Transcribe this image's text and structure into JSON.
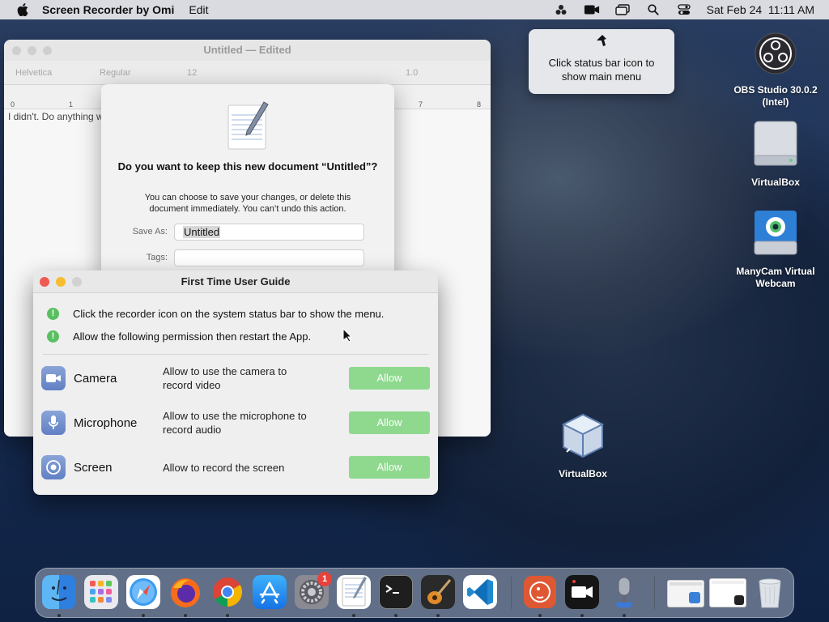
{
  "menubar": {
    "app_name": "Screen Recorder by Omi",
    "menu_edit": "Edit",
    "datetime": "Sat Feb 24  11:11 AM",
    "icons": [
      "apple-logo",
      "omi-icon",
      "camera-recorder-icon",
      "window-icon",
      "search-icon",
      "control-center-icon"
    ]
  },
  "tooltip": {
    "text": "Click status bar icon to show main menu"
  },
  "desktop": [
    {
      "name": "obs",
      "label": "OBS Studio 30.0.2 (Intel)"
    },
    {
      "name": "virtualbox-disk",
      "label": "VirtualBox"
    },
    {
      "name": "manycam",
      "label": "ManyCam Virtual Webcam"
    },
    {
      "name": "virtualbox-app",
      "label": "VirtualBox"
    }
  ],
  "textedit": {
    "title": "Untitled — Edited",
    "font": "Helvetica",
    "style": "Regular",
    "size": "12",
    "spacing": "1.0",
    "ruler": [
      "0",
      "1",
      "7",
      "8"
    ],
    "body_text": "I didn't. Do anything w"
  },
  "save_sheet": {
    "heading": "Do you want to keep this new document “Untitled”?",
    "description": "You can choose to save your changes, or delete this document immediately. You can’t undo this action.",
    "save_as_label": "Save As:",
    "save_as_value": "Untitled",
    "tags_label": "Tags:"
  },
  "guide": {
    "title": "First Time User Guide",
    "steps": [
      "Click the recorder icon on the system status bar to show the menu.",
      "Allow the following permission then restart the App."
    ],
    "permissions": [
      {
        "name": "Camera",
        "desc": "Allow to use the camera to record video",
        "button": "Allow"
      },
      {
        "name": "Microphone",
        "desc": "Allow to use the microphone to record audio",
        "button": "Allow"
      },
      {
        "name": "Screen",
        "desc": "Allow to record the screen",
        "button": "Allow"
      }
    ]
  },
  "dock": {
    "apps": [
      "Finder",
      "Launchpad",
      "Safari",
      "Firefox",
      "Chrome",
      "App Store",
      "System Preferences",
      "TextEdit",
      "Terminal",
      "GarageBand",
      "VS Code",
      "DuckDuckGo",
      "Screen Recorder",
      "Voice Recorder",
      "Window Preview 1",
      "Window Preview 2",
      "Trash"
    ],
    "settings_badge": "1"
  },
  "colors": {
    "allow_button": "#8fd98f",
    "step_dot": "#58c060",
    "close": "#ee5a52",
    "minimize": "#f5bd2f",
    "zoom": "#cfcfcf"
  }
}
